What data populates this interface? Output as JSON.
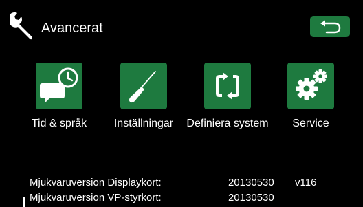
{
  "header": {
    "title": "Avancerat",
    "wrench_icon": "wrench-icon",
    "back_icon": "back-arrow-icon"
  },
  "colors": {
    "background": "#000000",
    "tile": "#1e7a3f",
    "text": "#ffffff"
  },
  "menu": [
    {
      "label": "Tid & språk",
      "icon": "clock-chat-icon"
    },
    {
      "label": "Inställningar",
      "icon": "screwdriver-icon"
    },
    {
      "label": "Definiera system",
      "icon": "cycle-arrows-icon"
    },
    {
      "label": "Service",
      "icon": "gears-icon"
    }
  ],
  "versions": [
    {
      "label": "Mjukvaruversion Displaykort:",
      "date": "20130530",
      "version": "v116"
    },
    {
      "label": "Mjukvaruversion VP-styrkort:",
      "date": "20130530",
      "version": ""
    }
  ]
}
